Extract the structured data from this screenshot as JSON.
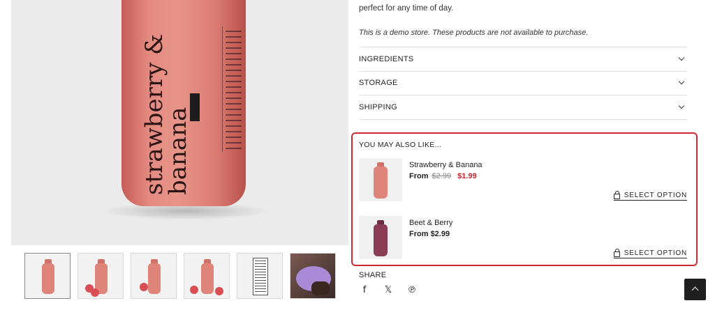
{
  "product": {
    "description_tail": "perfect for any time of day.",
    "demo_notice": "This is a demo store. These products are not available to purchase.",
    "bottle_text": "strawberry & banana"
  },
  "accordion": [
    {
      "label": "INGREDIENTS"
    },
    {
      "label": "STORAGE"
    },
    {
      "label": "SHIPPING"
    }
  ],
  "related": {
    "title": "YOU MAY ALSO LIKE...",
    "items": [
      {
        "name": "Strawberry & Banana",
        "from": "From",
        "old_price": "$2.99",
        "sale_price": "$1.99",
        "bottle_color": "#df8478",
        "action": "SELECT OPTION"
      },
      {
        "name": "Beet & Berry",
        "from": "From",
        "price": "$2.99",
        "bottle_color": "#8a3c55",
        "action": "SELECT OPTION"
      }
    ]
  },
  "share": {
    "label": "SHARE",
    "icons": [
      "facebook-icon",
      "x-icon",
      "pinterest-icon"
    ],
    "glyphs": {
      "facebook": "f",
      "x": "𝕏",
      "pinterest": "℗"
    }
  },
  "colors": {
    "highlight_border": "#cf2a31",
    "sale_price": "#c6262e",
    "bottle_pink": "#e48a80"
  }
}
